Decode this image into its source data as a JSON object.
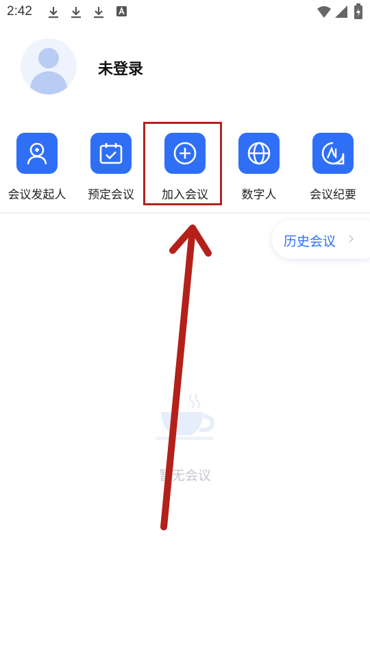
{
  "status_bar": {
    "time": "2:42",
    "icons": [
      "download-icon",
      "download-icon",
      "download-icon",
      "a-icon",
      "wifi-icon",
      "signal-icon",
      "battery-icon"
    ]
  },
  "profile": {
    "avatar_icon": "user-avatar-icon",
    "login_status": "未登录"
  },
  "shortcuts": [
    {
      "label": "会议发起人",
      "icon": "host-user-icon"
    },
    {
      "label": "预定会议",
      "icon": "calendar-check-icon"
    },
    {
      "label": "加入会议",
      "icon": "plus-circle-icon"
    },
    {
      "label": "数字人",
      "icon": "globe-icon"
    },
    {
      "label": "会议纪要",
      "icon": "ai-notes-icon"
    }
  ],
  "history": {
    "label": "历史会议",
    "icon": "chevron-right-icon"
  },
  "empty_state": {
    "icon": "coffee-cup-icon",
    "text": "暂无会议"
  },
  "colors": {
    "accent": "#2f6ff6",
    "annotation": "#b3211a",
    "empty_text": "#c3c7ce"
  }
}
